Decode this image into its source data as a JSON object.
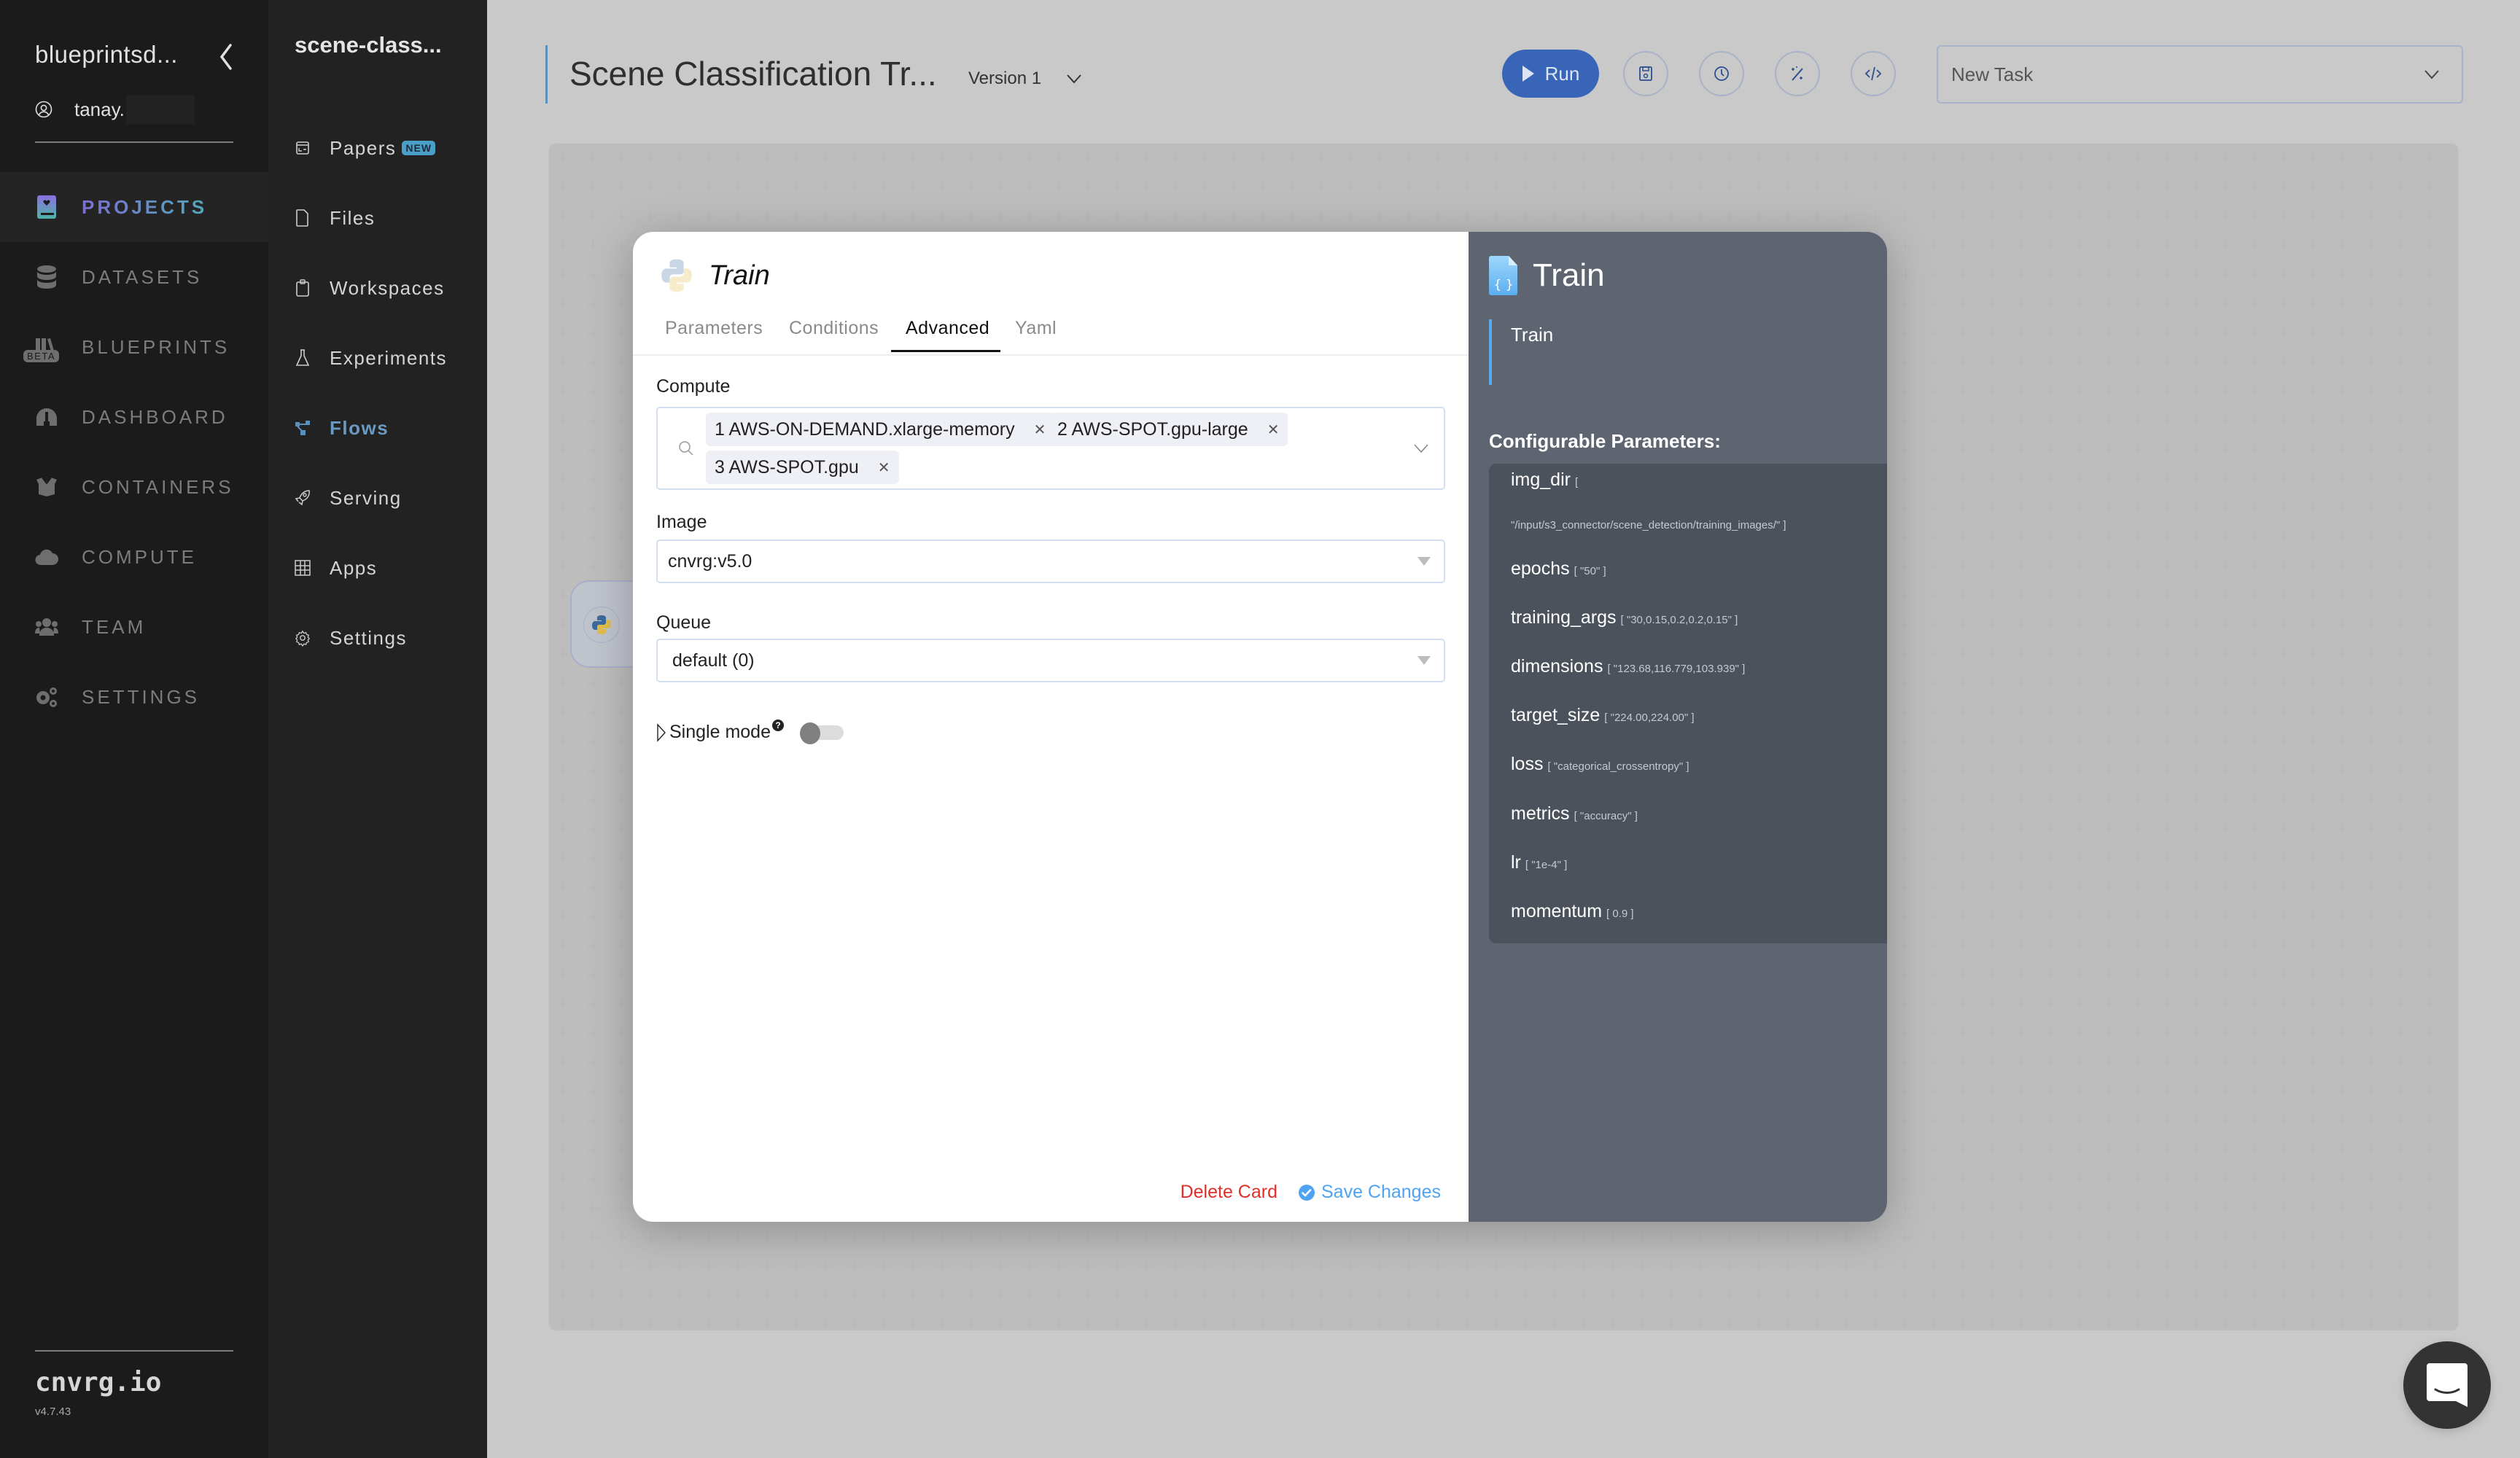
{
  "sidebar": {
    "org_name": "blueprintsd...",
    "username": "tanay.",
    "items": [
      {
        "label": "PROJECTS",
        "icon": "projects-icon",
        "active": true
      },
      {
        "label": "DATASETS",
        "icon": "database-icon"
      },
      {
        "label": "BLUEPRINTS",
        "icon": "blueprints-icon",
        "badge": "BETA"
      },
      {
        "label": "DASHBOARD",
        "icon": "dashboard-icon"
      },
      {
        "label": "CONTAINERS",
        "icon": "containers-icon"
      },
      {
        "label": "COMPUTE",
        "icon": "cloud-icon"
      },
      {
        "label": "TEAM",
        "icon": "team-icon"
      },
      {
        "label": "SETTINGS",
        "icon": "settings-gears-icon"
      }
    ],
    "brand": "cnvrg.io",
    "version": "v4.7.43"
  },
  "project_nav": {
    "project_name": "scene-class...",
    "items": [
      {
        "label": "Papers",
        "icon": "papers-icon",
        "badge": "NEW"
      },
      {
        "label": "Files",
        "icon": "file-icon"
      },
      {
        "label": "Workspaces",
        "icon": "clipboard-icon"
      },
      {
        "label": "Experiments",
        "icon": "flask-icon"
      },
      {
        "label": "Flows",
        "icon": "flows-icon",
        "active": true
      },
      {
        "label": "Serving",
        "icon": "rocket-icon"
      },
      {
        "label": "Apps",
        "icon": "grid-icon"
      },
      {
        "label": "Settings",
        "icon": "gear-icon"
      }
    ]
  },
  "header": {
    "flow_title": "Scene Classification Tr...",
    "version_label": "Version 1",
    "run_label": "Run",
    "toolbar_icons": [
      "save-icon",
      "history-icon",
      "magic-wand-icon",
      "code-icon"
    ],
    "task_select": "New Task"
  },
  "modal": {
    "title": "Train",
    "tabs": [
      "Parameters",
      "Conditions",
      "Advanced",
      "Yaml"
    ],
    "active_tab": "Advanced",
    "compute": {
      "label": "Compute",
      "selected": [
        "1 AWS-ON-DEMAND.xlarge-memory",
        "2 AWS-SPOT.gpu-large",
        "3 AWS-SPOT.gpu"
      ]
    },
    "image": {
      "label": "Image",
      "value": "cnvrg:v5.0"
    },
    "queue": {
      "label": "Queue",
      "value": "default (0)"
    },
    "single_mode": {
      "label": "Single mode",
      "help": "?",
      "enabled": false
    },
    "delete_label": "Delete Card",
    "save_label": "Save Changes",
    "colors": {
      "delete": "#e0302a",
      "save": "#4ea3f2",
      "run": "#3965b8"
    }
  },
  "info_panel": {
    "title": "Train",
    "description": "Train",
    "configurable_label": "Configurable Parameters:",
    "params": [
      {
        "name": "img_dir",
        "value": "[",
        "value_cont": "\"/input/s3_connector/scene_detection/training_images/\" ]"
      },
      {
        "name": "epochs",
        "value": "[ \"50\" ]"
      },
      {
        "name": "training_args",
        "value": "[ \"30,0.15,0.2,0.2,0.15\" ]"
      },
      {
        "name": "dimensions",
        "value": "[ \"123.68,116.779,103.939\" ]"
      },
      {
        "name": "target_size",
        "value": "[ \"224.00,224.00\" ]"
      },
      {
        "name": "loss",
        "value": "[ \"categorical_crossentropy\" ]"
      },
      {
        "name": "metrics",
        "value": "[ \"accuracy\" ]"
      },
      {
        "name": "lr",
        "value": "[ \"1e-4\" ]"
      },
      {
        "name": "momentum",
        "value": "[ 0.9 ]"
      }
    ]
  }
}
